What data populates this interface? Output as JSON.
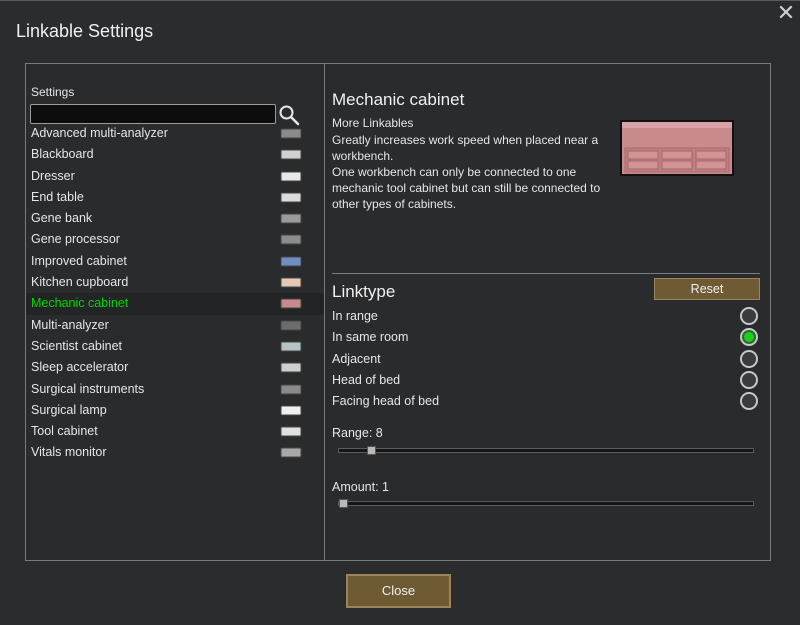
{
  "window": {
    "title": "Linkable Settings",
    "close_icon": "close-icon"
  },
  "left": {
    "settings_label": "Settings",
    "search": {
      "value": "",
      "placeholder": ""
    },
    "items": [
      {
        "label": "Advanced multi-analyzer"
      },
      {
        "label": "Blackboard"
      },
      {
        "label": "Dresser"
      },
      {
        "label": "End table"
      },
      {
        "label": "Gene bank"
      },
      {
        "label": "Gene processor"
      },
      {
        "label": "Improved cabinet"
      },
      {
        "label": "Kitchen cupboard"
      },
      {
        "label": "Mechanic cabinet"
      },
      {
        "label": "Multi-analyzer"
      },
      {
        "label": "Scientist cabinet"
      },
      {
        "label": "Sleep accelerator"
      },
      {
        "label": "Surgical instruments"
      },
      {
        "label": "Surgical lamp"
      },
      {
        "label": "Tool cabinet"
      },
      {
        "label": "Vitals monitor"
      }
    ],
    "selected_index": 8
  },
  "right": {
    "item_title": "Mechanic cabinet",
    "more_link": "More Linkables",
    "description": [
      "Greatly increases work speed when placed near a workbench.",
      "One workbench can only be connected to one mechanic tool cabinet but can still be connected to other types of cabinets."
    ],
    "linktype_title": "Linktype",
    "reset_label": "Reset",
    "options": [
      {
        "label": "In range",
        "checked": false
      },
      {
        "label": "In same room",
        "checked": true
      },
      {
        "label": "Adjacent",
        "checked": false
      },
      {
        "label": "Head of bed",
        "checked": false
      },
      {
        "label": "Facing head of bed",
        "checked": false
      }
    ],
    "range": {
      "label": "Range: 8",
      "fraction": 0.07
    },
    "amount": {
      "label": "Amount: 1",
      "fraction": 0.0
    }
  },
  "footer": {
    "close_label": "Close"
  },
  "colors": {
    "accent_selected_text": "#00d500",
    "button_bg": "#6e5a33",
    "radio_checked": "#1fcc1f"
  }
}
